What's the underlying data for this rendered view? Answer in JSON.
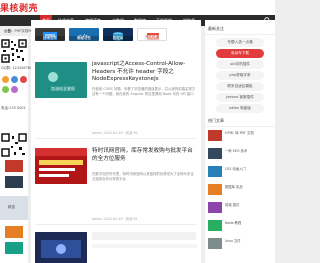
{
  "site": {
    "logo": "果核剥壳"
  },
  "nav": {
    "items": [
      "首页",
      "技术文章",
      "编程语言",
      "大数据",
      "数据库",
      "开发框架",
      "架构师"
    ],
    "active_index": 1,
    "search_icon": "search-icon"
  },
  "notice": {
    "label": "公告：",
    "text": "PHP实现Mysql数据库备份和还原方式"
  },
  "categories": [
    {
      "label": "技术文章"
    },
    {
      "label": "编程语言"
    },
    {
      "label": "数据库"
    },
    {
      "label": "开发框架"
    }
  ],
  "articles": [
    {
      "thumb_caption": "加油站全鉴权",
      "title": "javascript之Access-Control-Allow-Headers 不允许 header 字段之 NodeExpressKeystoneJs",
      "excerpt": "在使用 CORS 问题，来看了浏览器的错误提示，并以我的前端实现方法有一个问题，我在我的 Angular 项目里调用 Node 写的 API 接口",
      "meta": "admin 2024-04-18 · 阅读 99"
    },
    {
      "thumb_caption": "",
      "title": "特时讯网官网，库存常发收购与批发平台的全方位服务",
      "excerpt": "在数字化的时代里，特时讯网官网以其独特的优势成为了全球众多企业选择合作伙伴的平台",
      "meta": "admin 2024-04-18 · 阅读 85"
    },
    {
      "thumb_caption": "",
      "title": "",
      "excerpt": "",
      "meta": ""
    }
  ],
  "right": {
    "latest_head": "最新关注",
    "pills": [
      {
        "label": "专题入选一点通",
        "red": false
      },
      {
        "label": "电动车下载",
        "red": true
      },
      {
        "label": "ubi中的插件",
        "red": false
      },
      {
        "label": "php获取字条",
        "red": false
      },
      {
        "label": "联系自适应模板",
        "red": false
      },
      {
        "label": "Jeeone 客服插件",
        "red": false
      },
      {
        "label": "kates 电脑版",
        "red": false
      }
    ],
    "hot_head": "热门文章",
    "hot": [
      {
        "text": "HTML 转 PDF 文档"
      },
      {
        "text": "一种 SEO 技术"
      },
      {
        "text": "CSS 动画入门"
      },
      {
        "text": "数据库 实战"
      },
      {
        "text": "前端 插件"
      },
      {
        "text": "Node 教程"
      },
      {
        "text": "linux 文件"
      }
    ]
  },
  "left": {
    "contact": "QQ群: 123456789",
    "phone": "电话:135 0001",
    "thumb_caption": "精选"
  }
}
